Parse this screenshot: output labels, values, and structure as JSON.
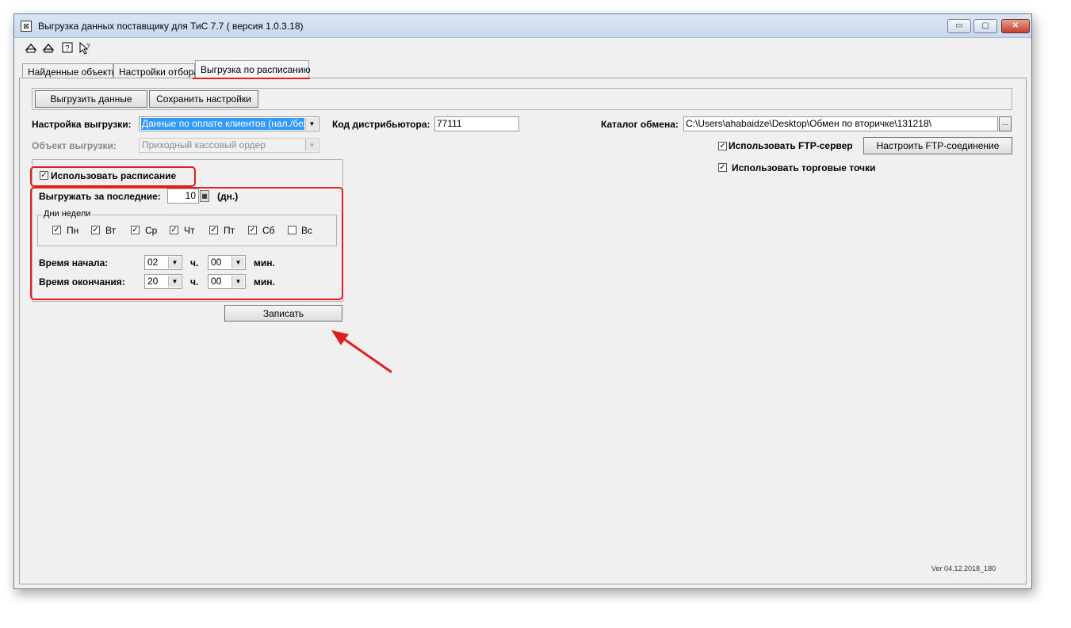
{
  "window": {
    "title": "Выгрузка данных поставщику для ТиС 7.7 ( версия 1.0.3.18)",
    "controls": {
      "minimize": "▭",
      "maximize": "▢",
      "close": "✕"
    }
  },
  "toolbar": {
    "tools": [
      "tool-1",
      "tool-2",
      "help",
      "pointer-help"
    ]
  },
  "tabs": [
    "Найденные объекты",
    "Настройки отбора",
    "Выгрузка по расписанию"
  ],
  "actions": {
    "export": "Выгрузить данные",
    "save_settings": "Сохранить настройки"
  },
  "form": {
    "export_setting_label": "Настройка выгрузки:",
    "export_setting_value": "Данные по оплате клиентов (нал./безнал)",
    "distributor_code_label": "Код дистрибьютора:",
    "distributor_code_value": "77111",
    "exchange_dir_label": "Каталог обмена:",
    "exchange_dir_value": "C:\\Users\\ahabaidze\\Desktop\\Обмен по вторичке\\131218\\",
    "browse": "...",
    "export_object_label": "Объект выгрузки:",
    "export_object_value": "Приходный кассовый ордер",
    "use_ftp_label": "Использовать FTP-сервер",
    "ftp_button": "Настроить FTP-соединение",
    "use_points_label": "Использовать торговые точки"
  },
  "schedule": {
    "use_schedule_label": "Использовать расписание",
    "last_days_label": "Выгружать за последние:",
    "last_days_value": "10",
    "days_unit": "(дн.)",
    "weekdays_title": "Дни недели",
    "weekdays": [
      {
        "label": "Пн",
        "checked": true
      },
      {
        "label": "Вт",
        "checked": true
      },
      {
        "label": "Ср",
        "checked": true
      },
      {
        "label": "Чт",
        "checked": true
      },
      {
        "label": "Пт",
        "checked": true
      },
      {
        "label": "Сб",
        "checked": true
      },
      {
        "label": "Вс",
        "checked": false
      }
    ],
    "start_label": "Время начала:",
    "end_label": "Время окончания:",
    "start_hour": "02",
    "start_min": "00",
    "end_hour": "20",
    "end_min": "00",
    "hour_unit": "ч.",
    "min_unit": "мин.",
    "save_button": "Записать"
  },
  "version": "Ver 04.12.2018_180",
  "colors": {
    "annotation": "#e02020",
    "selection": "#3399ff"
  }
}
